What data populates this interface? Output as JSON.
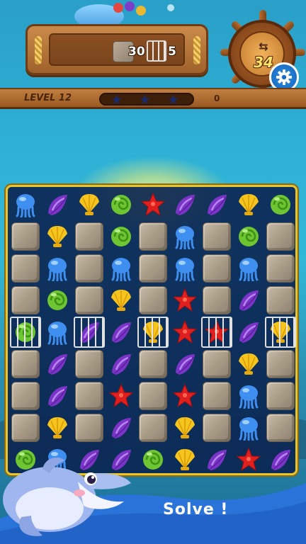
{
  "hud": {
    "rock_goal": "30",
    "cage_goal": "5",
    "moves_left": "34",
    "swap_symbol": "⇆",
    "level_label": "LEVEL 12",
    "score": "0",
    "stars_total": 3
  },
  "board": {
    "rows": 9,
    "cols": 9,
    "legend": {
      "J": "jellyfish",
      "P": "purple-shell",
      "Y": "yellow-scallop",
      "G": "green-snail",
      "R": "red-starfish",
      "X": "rock-block"
    },
    "grid": [
      [
        "J",
        "P",
        "Y",
        "G",
        "R",
        "P",
        "P",
        "Y",
        "G"
      ],
      [
        "X",
        "Y",
        "X",
        "G",
        "X",
        "J",
        "X",
        "G",
        "X"
      ],
      [
        "X",
        "J",
        "X",
        "J",
        "X",
        "J",
        "X",
        "J",
        "X"
      ],
      [
        "X",
        "G",
        "X",
        "Y",
        "X",
        "R",
        "X",
        "P",
        "X"
      ],
      [
        "G",
        "J",
        "P",
        "P",
        "Y",
        "R",
        "R",
        "P",
        "Y"
      ],
      [
        "X",
        "P",
        "X",
        "P",
        "X",
        "P",
        "X",
        "Y",
        "X"
      ],
      [
        "X",
        "P",
        "X",
        "R",
        "X",
        "R",
        "X",
        "J",
        "X"
      ],
      [
        "X",
        "Y",
        "X",
        "P",
        "X",
        "Y",
        "X",
        "J",
        "X"
      ],
      [
        "G",
        "J",
        "P",
        "P",
        "G",
        "Y",
        "P",
        "R",
        "P"
      ]
    ],
    "caged": [
      [
        4,
        0
      ],
      [
        4,
        2
      ],
      [
        4,
        4
      ],
      [
        4,
        6
      ],
      [
        4,
        8
      ]
    ]
  },
  "colors": {
    "jellyfish": "#3f8ff0",
    "purple-shell": "#7b34c8",
    "yellow-scallop": "#f5c51e",
    "green-snail": "#6cc531",
    "red-starfish": "#e0201e",
    "board_frame": "#e8c52e"
  },
  "footer": {
    "caption": "Solve !"
  }
}
